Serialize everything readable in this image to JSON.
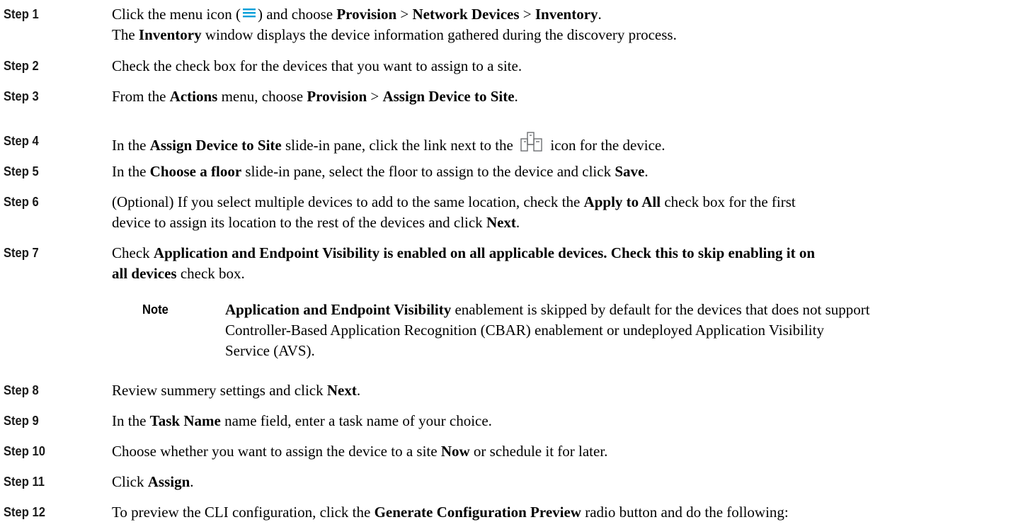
{
  "steps": [
    {
      "label": "Step 1",
      "text_a": "Click the menu icon (",
      "text_b": ") and choose ",
      "b1": "Provision",
      "sep1": " > ",
      "b2": "Network Devices",
      "sep2": " > ",
      "b3": "Inventory",
      "end": ".",
      "line2_b": "Inventory",
      "line2": " window displays the device information gathered during the discovery process."
    },
    {
      "label": "Step 2",
      "text": "Check the check box for the devices that you want to assign to a site."
    },
    {
      "label": "Step 3",
      "a": "From the ",
      "b1": "Actions",
      "c": " menu, choose ",
      "b2": "Provision",
      "d": " > ",
      "b3": "Assign Device to Site",
      "e": "."
    },
    {
      "label": "Step 4",
      "a": "In the ",
      "b1": "Assign Device to Site",
      "c": " slide-in pane, click the link next to the ",
      "d": " icon for the device."
    },
    {
      "label": "Step 5",
      "a": "In the ",
      "b1": "Choose a floor",
      "c": " slide-in pane, select the floor to assign to the device and click ",
      "b2": "Save",
      "d": "."
    },
    {
      "label": "Step 6",
      "a": "(Optional) If you select multiple devices to add to the same location, check the ",
      "b1": "Apply to All",
      "c": " check box for the first",
      "line2": "device to assign its location to the rest of the devices and click ",
      "b2": "Next",
      "d": "."
    },
    {
      "label": "Step 7",
      "a": "Check ",
      "b1": "Application and Endpoint Visibility is enabled on all applicable devices. Check this to skip enabling it on",
      "b2": "all devices",
      "c": " check box.",
      "note_label": "Note",
      "note_b": "Application and Endpoint Visibility",
      "note_1": " enablement is skipped by default for the devices that does not support",
      "note_2": "Controller-Based Application Recognition (CBAR) enablement or undeployed Application Visibility",
      "note_3": "Service (AVS)."
    },
    {
      "label": "Step 8",
      "a": "Review summery settings and click ",
      "b1": "Next",
      "c": "."
    },
    {
      "label": "Step 9",
      "a": "In the ",
      "b1": "Task Name",
      "c": " name field, enter a task name of your choice."
    },
    {
      "label": "Step 10",
      "a": "Choose whether you want to assign the device to a site ",
      "b1": "Now",
      "c": " or schedule it for later."
    },
    {
      "label": "Step 11",
      "a": "Click ",
      "b1": "Assign",
      "c": "."
    },
    {
      "label": "Step 12",
      "a": "To preview the CLI configuration, click the ",
      "b1": "Generate Configuration Preview",
      "c": " radio button and do the following:"
    }
  ],
  "icons": {
    "menu": "menu-icon",
    "site": "site-hierarchy-icon",
    "menu_color": "#049fd9",
    "site_color": "#6d6e71"
  }
}
